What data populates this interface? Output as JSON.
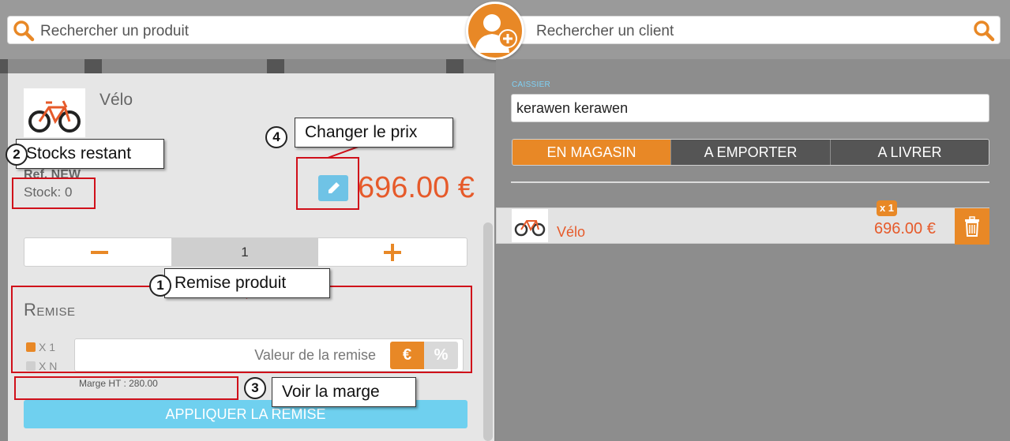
{
  "search": {
    "product_placeholder": "Rechercher un produit",
    "client_placeholder": "Rechercher un client"
  },
  "product": {
    "name": "Vélo",
    "ref": "Ref. NEW",
    "stock": "Stock: 0",
    "price": "696.00 €",
    "quantity": "1"
  },
  "remise": {
    "title": "Remise",
    "option_x1": "X 1",
    "option_xn": "X N",
    "placeholder": "Valeur de la remise",
    "euro_label": "€",
    "percent_label": "%",
    "marge": "Marge HT : 280.00",
    "apply_label": "APPLIQUER LA REMISE"
  },
  "right": {
    "caissier_label": "CAISSIER",
    "caissier_value": "kerawen kerawen",
    "tabs": [
      "EN MAGASIN",
      "A EMPORTER",
      "A LIVRER"
    ],
    "active_tab": "EN MAGASIN"
  },
  "cart": {
    "items": [
      {
        "name": "Vélo",
        "price": "696.00 €",
        "qty": "x 1"
      }
    ]
  },
  "annotations": {
    "a1": {
      "num": "1",
      "label": "Remise produit"
    },
    "a2": {
      "num": "2",
      "label": "Stocks restant"
    },
    "a3": {
      "num": "3",
      "label": "Voir la marge"
    },
    "a4": {
      "num": "4",
      "label": "Changer le prix"
    }
  },
  "colors": {
    "accent": "#e88826",
    "price": "#e65a2a",
    "action_blue": "#6fc3e6",
    "annotation_red": "#d0101a"
  },
  "icons": [
    "search-icon",
    "add-user-icon",
    "bicycle-icon",
    "pencil-icon",
    "trash-icon",
    "minus-icon",
    "plus-icon"
  ]
}
